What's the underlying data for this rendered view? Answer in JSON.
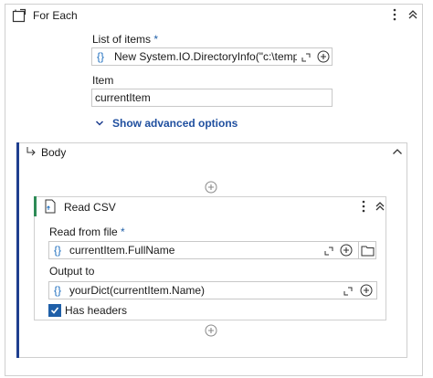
{
  "foreach": {
    "title": "For Each",
    "list_label": "List of items",
    "list_required": "*",
    "list_value": "New System.IO.DirectoryInfo(\"c:\\temp\").G",
    "expr_symbol": "{}",
    "item_label": "Item",
    "item_value": "currentItem",
    "advanced_toggle": "Show advanced options"
  },
  "body": {
    "title": "Body"
  },
  "readcsv": {
    "title": "Read CSV",
    "file_label": "Read from file",
    "file_required": "*",
    "file_value": "currentItem.FullName",
    "output_label": "Output to",
    "output_value": "yourDict(currentItem.Name)",
    "headers_label": "Has headers",
    "headers_checked": true
  },
  "colors": {
    "accent": "#1f6fbf",
    "left_bar": "#1f3f8f",
    "readcsv_bar": "#2e8b57"
  }
}
